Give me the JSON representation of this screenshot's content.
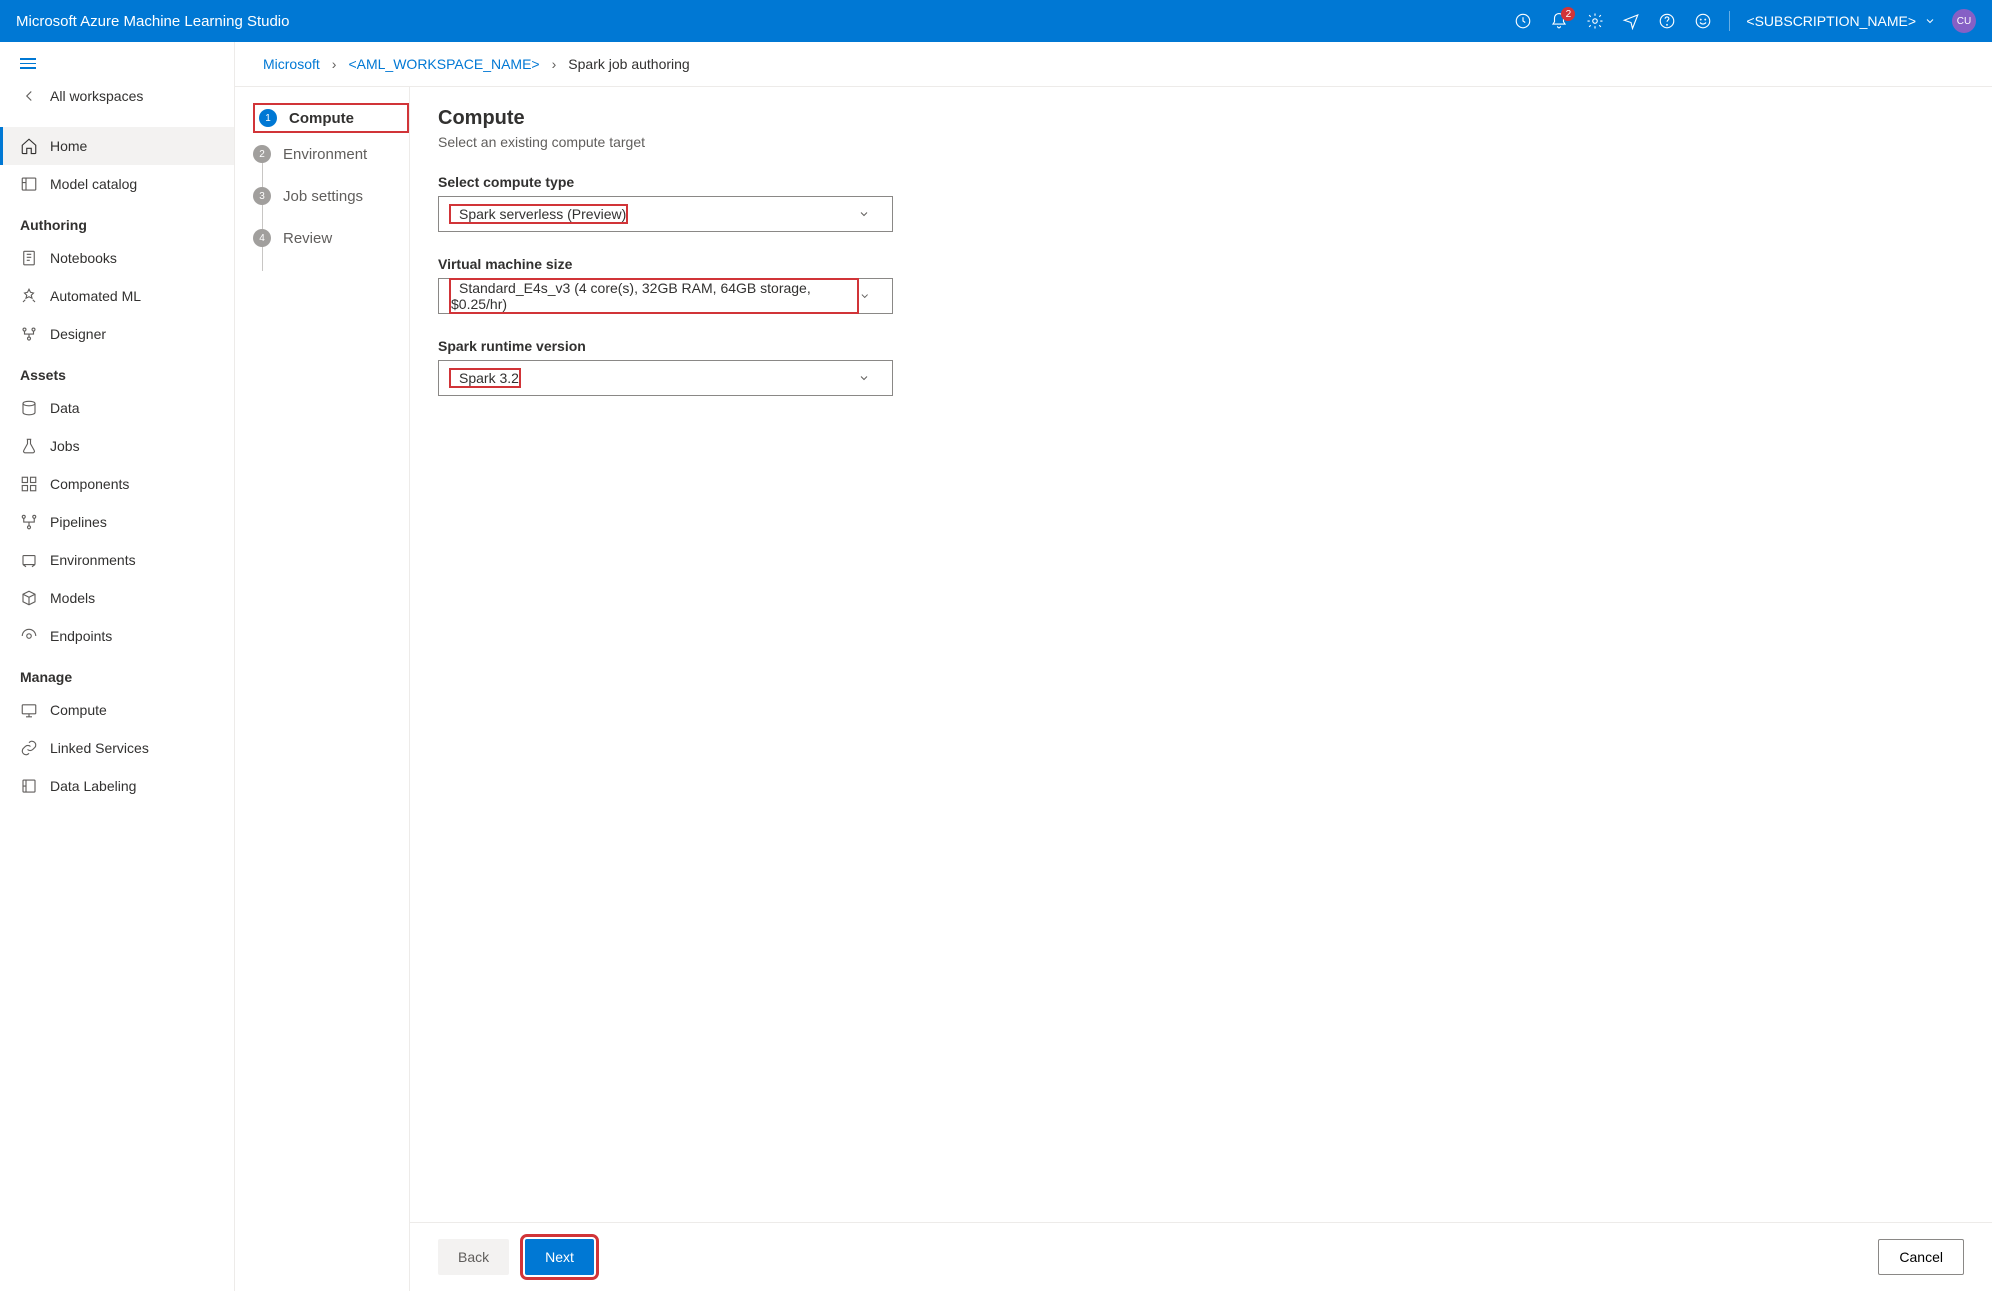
{
  "topbar": {
    "title": "Microsoft Azure Machine Learning Studio",
    "notification_count": "2",
    "subscription": "<SUBSCRIPTION_NAME>",
    "avatar_initials": "CU"
  },
  "sidebar": {
    "all_workspaces": "All workspaces",
    "items": [
      {
        "label": "Home",
        "icon": "home"
      },
      {
        "label": "Model catalog",
        "icon": "catalog"
      }
    ],
    "sections": [
      {
        "heading": "Authoring",
        "items": [
          {
            "label": "Notebooks",
            "icon": "notebook"
          },
          {
            "label": "Automated ML",
            "icon": "automl"
          },
          {
            "label": "Designer",
            "icon": "designer"
          }
        ]
      },
      {
        "heading": "Assets",
        "items": [
          {
            "label": "Data",
            "icon": "data"
          },
          {
            "label": "Jobs",
            "icon": "flask"
          },
          {
            "label": "Components",
            "icon": "components"
          },
          {
            "label": "Pipelines",
            "icon": "pipeline"
          },
          {
            "label": "Environments",
            "icon": "env"
          },
          {
            "label": "Models",
            "icon": "box"
          },
          {
            "label": "Endpoints",
            "icon": "endpoint"
          }
        ]
      },
      {
        "heading": "Manage",
        "items": [
          {
            "label": "Compute",
            "icon": "compute"
          },
          {
            "label": "Linked Services",
            "icon": "link"
          },
          {
            "label": "Data Labeling",
            "icon": "label"
          }
        ]
      }
    ]
  },
  "breadcrumb": {
    "root": "Microsoft",
    "workspace": "<AML_WORKSPACE_NAME>",
    "current": "Spark job authoring"
  },
  "wizard": {
    "steps": [
      {
        "num": "1",
        "label": "Compute",
        "active": true
      },
      {
        "num": "2",
        "label": "Environment",
        "active": false
      },
      {
        "num": "3",
        "label": "Job settings",
        "active": false
      },
      {
        "num": "4",
        "label": "Review",
        "active": false
      }
    ],
    "title": "Compute",
    "subtitle": "Select an existing compute target",
    "fields": {
      "compute_type": {
        "label": "Select compute type",
        "value": "Spark serverless (Preview)"
      },
      "vm_size": {
        "label": "Virtual machine size",
        "value": "Standard_E4s_v3 (4 core(s), 32GB RAM, 64GB storage, $0.25/hr)"
      },
      "spark_runtime": {
        "label": "Spark runtime version",
        "value": "Spark 3.2"
      }
    },
    "footer": {
      "back": "Back",
      "next": "Next",
      "cancel": "Cancel"
    }
  }
}
